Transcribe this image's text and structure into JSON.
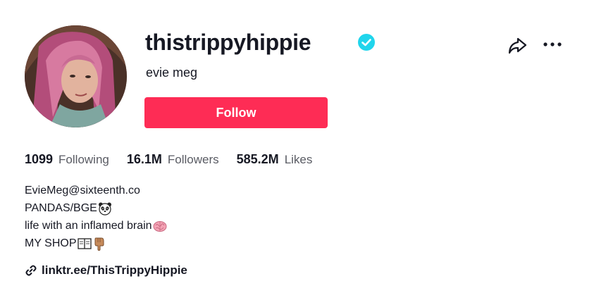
{
  "profile": {
    "username": "thistrippyhippie",
    "nickname": "evie meg",
    "verified": true,
    "follow_label": "Follow",
    "accent_color": "#fe2c55",
    "verified_color": "#20d5ec"
  },
  "stats": {
    "following_count": "1099",
    "following_label": "Following",
    "followers_count": "16.1M",
    "followers_label": "Followers",
    "likes_count": "585.2M",
    "likes_label": "Likes"
  },
  "bio": {
    "line1": "EvieMeg@sixteenth.co",
    "line2": "PANDAS/BGE",
    "line2_emoji": "panda-face-icon",
    "line3": "life with an inflamed brain",
    "line3_emoji": "brain-icon",
    "line4": "MY SHOP",
    "line4_emojis": [
      "open-book-icon",
      "pointing-down-icon"
    ]
  },
  "link": {
    "text": "linktr.ee/ThisTrippyHippie",
    "icon": "link-icon"
  },
  "actions": {
    "share_icon": "share-icon",
    "more_icon": "more-icon"
  }
}
